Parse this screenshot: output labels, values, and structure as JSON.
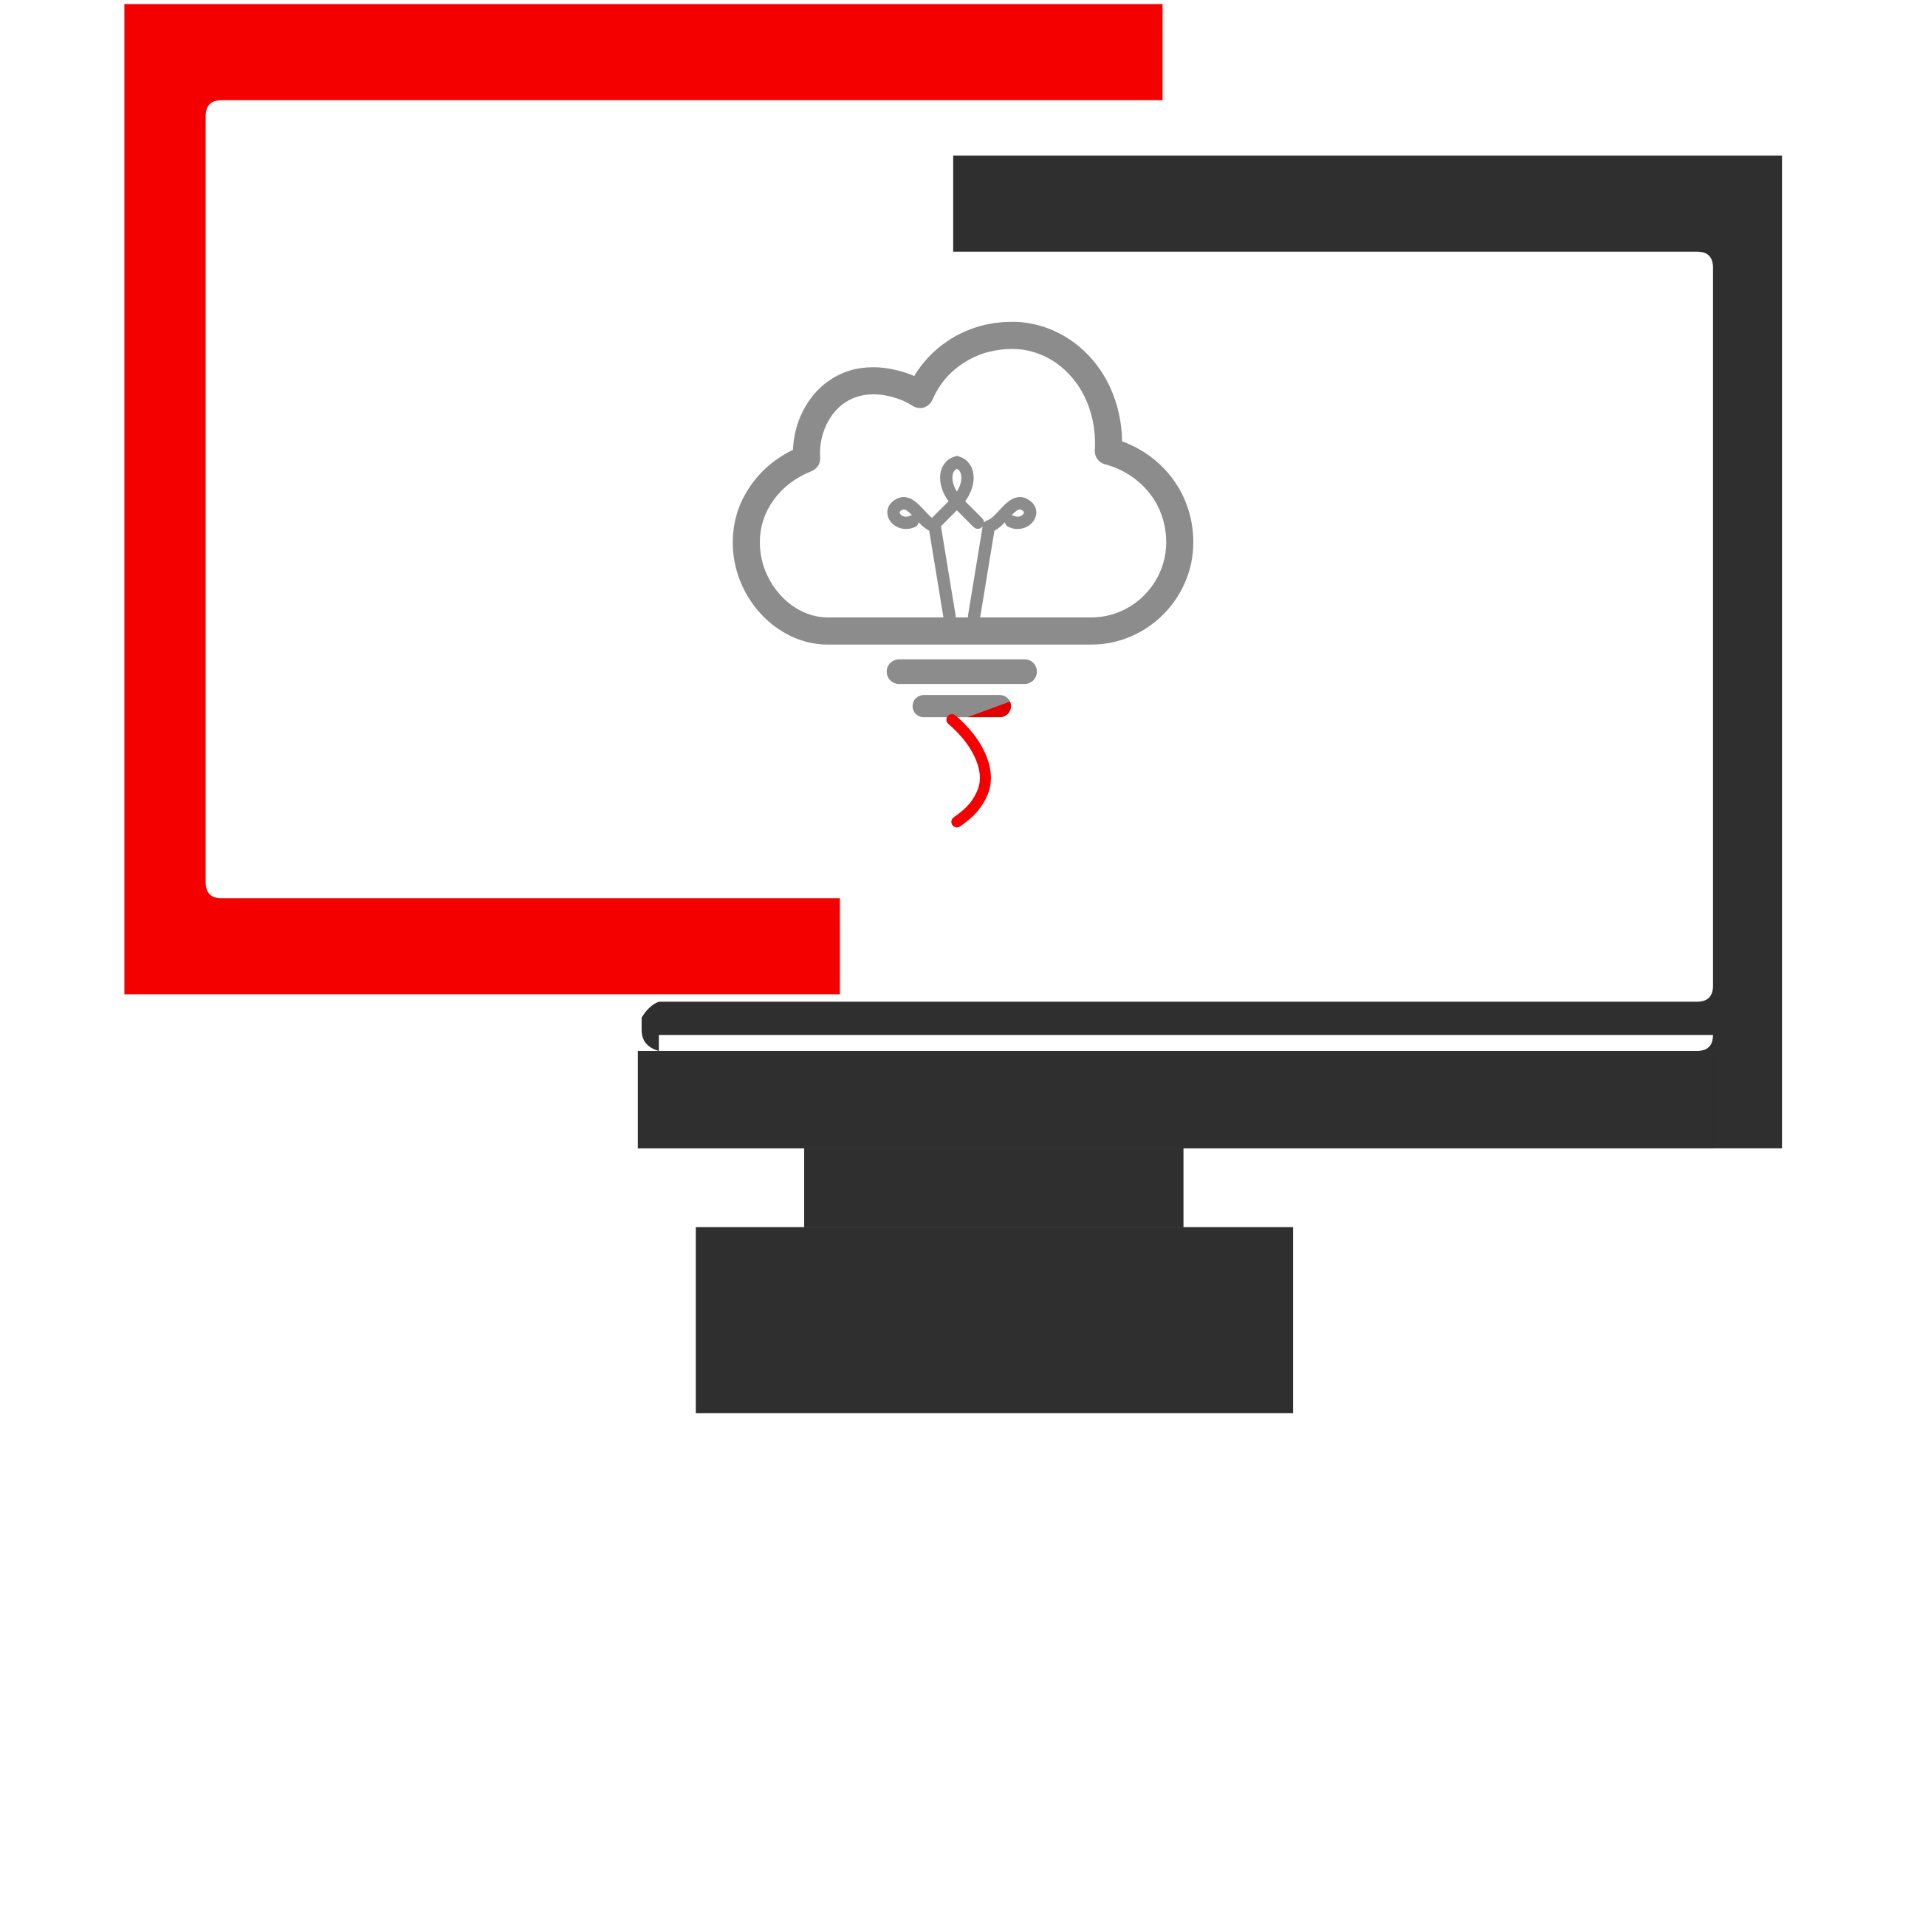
{
  "logo": {
    "icon_name": "cloud-lightbulb-monitor-logo",
    "brand_colors": {
      "red": "#f50000",
      "dark": "#2f2f2f",
      "gray": "#8c8c8c",
      "background": "#ffffff"
    },
    "parts": {
      "back_frame": "red-screen-frame-icon",
      "front_monitor": "monitor-icon",
      "center_symbol": "cloud-lightbulb-icon"
    }
  }
}
